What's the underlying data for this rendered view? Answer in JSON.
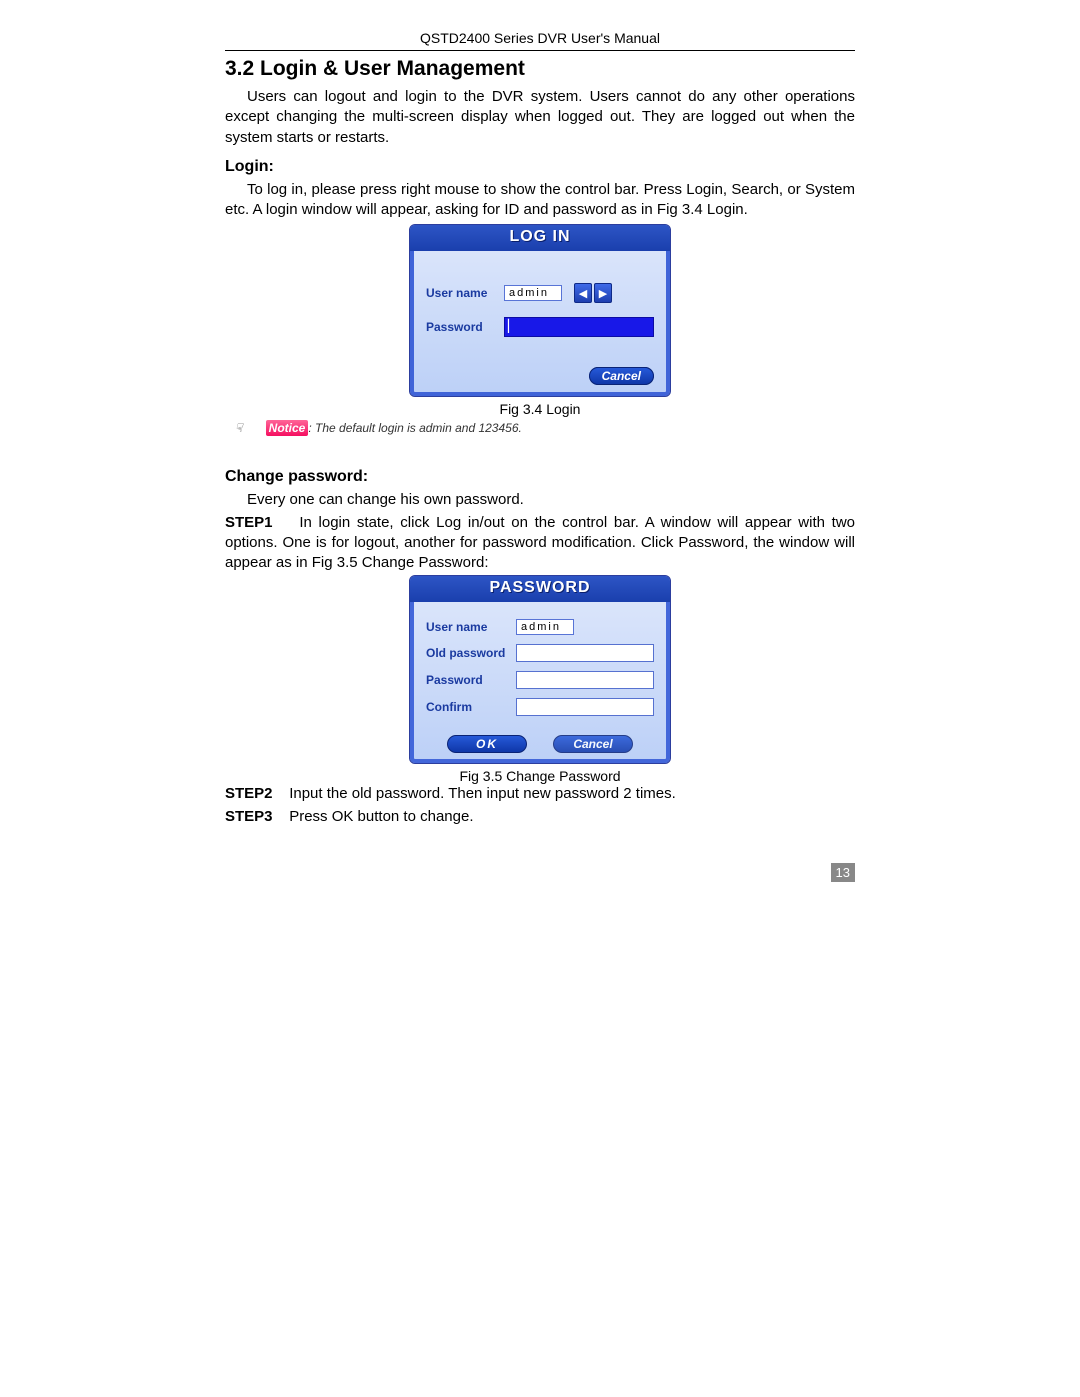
{
  "header": "QSTD2400 Series DVR User's Manual",
  "section_title": "3.2  Login & User Management",
  "intro": "Users can logout and login to the DVR system. Users cannot do any other operations except changing the multi-screen display when logged out. They are logged out when the system starts or restarts.",
  "login": {
    "heading": "Login:",
    "text": "To log in, please press right mouse to show the control bar. Press Login, Search, or System etc. A login window will appear, asking for ID and password as in Fig 3.4 Login.",
    "caption": "Fig 3.4 Login"
  },
  "notice": {
    "label": "Notice",
    "text": ": The default login is admin and 123456."
  },
  "change": {
    "heading": "Change password:",
    "text0": "Every one can change his own password.",
    "step1_label": "STEP1",
    "step1_text": "In login state, click Log in/out on the control bar. A window will appear with two options. One is for logout, another for password modification. Click Password, the window will appear as in Fig 3.5    Change Password:",
    "caption": "Fig 3.5    Change Password",
    "step2_label": "STEP2",
    "step2_text": "Input the old password. Then input new password 2 times.",
    "step3_label": "STEP3",
    "step3_text": "Press OK button to change."
  },
  "dlg_login": {
    "title": "LOG IN",
    "user_label": "User name",
    "user_value": "admin",
    "pw_label": "Password",
    "cancel": "Cancel"
  },
  "dlg_pw": {
    "title": "PASSWORD",
    "user_label": "User name",
    "user_value": "admin",
    "old_label": "Old password",
    "pw_label": "Password",
    "confirm_label": "Confirm",
    "ok": "OK",
    "cancel": "Cancel"
  },
  "page_number": "13"
}
